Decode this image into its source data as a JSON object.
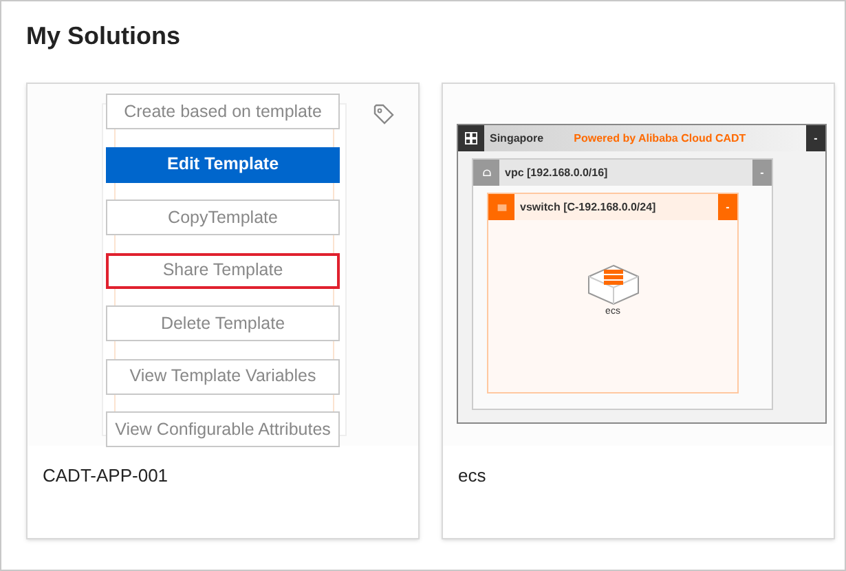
{
  "title": "My Solutions",
  "solutions": [
    {
      "name": "CADT-APP-001",
      "kind": "menu",
      "menu": [
        {
          "label": "Create based on template",
          "primary": false,
          "highlighted": false
        },
        {
          "label": "Edit Template",
          "primary": true,
          "highlighted": false
        },
        {
          "label": "CopyTemplate",
          "primary": false,
          "highlighted": false
        },
        {
          "label": "Share Template",
          "primary": false,
          "highlighted": true
        },
        {
          "label": "Delete Template",
          "primary": false,
          "highlighted": false
        },
        {
          "label": "View Template Variables",
          "primary": false,
          "highlighted": false
        },
        {
          "label": "View Configurable Attributes",
          "primary": false,
          "highlighted": false
        }
      ]
    },
    {
      "name": "ecs",
      "kind": "diagram",
      "diagram": {
        "region": {
          "label": "Singapore",
          "collapse": "-"
        },
        "brand": "Powered by Alibaba Cloud CADT",
        "vpc": {
          "label": "vpc [192.168.0.0/16]",
          "collapse": "-"
        },
        "vswitch": {
          "label": "vswitch [C-192.168.0.0/24]",
          "collapse": "-"
        },
        "instance": "ecs"
      }
    }
  ]
}
